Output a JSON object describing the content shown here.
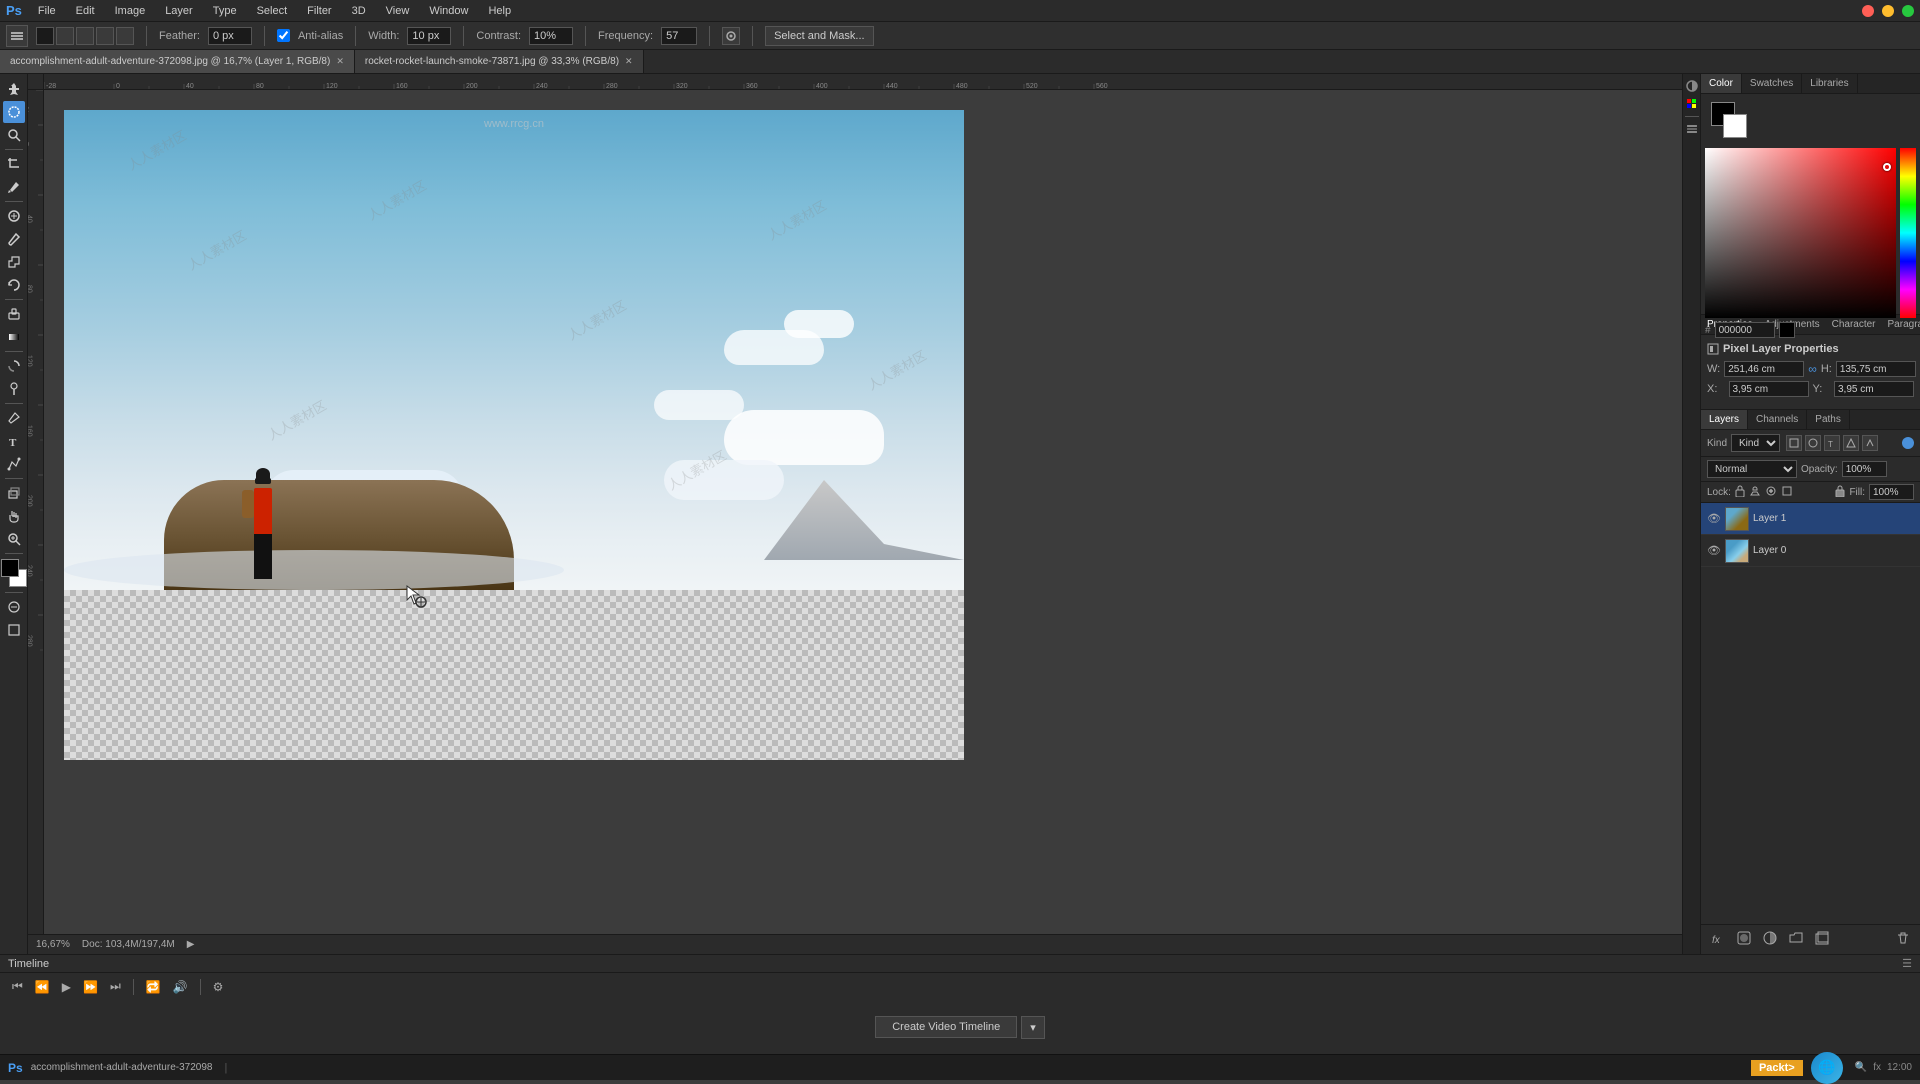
{
  "app": {
    "title": "Adobe Photoshop",
    "watermark": "www.rrcg.cn"
  },
  "menu": {
    "items": [
      "PS",
      "File",
      "Edit",
      "Image",
      "Layer",
      "Type",
      "Select",
      "Filter",
      "3D",
      "View",
      "Window",
      "Help"
    ]
  },
  "toolbar": {
    "feather_label": "Feather:",
    "feather_value": "0 px",
    "antialias_label": "Anti-alias",
    "width_label": "Width:",
    "width_value": "10 px",
    "contrast_label": "Contrast:",
    "contrast_value": "10%",
    "frequency_label": "Frequency:",
    "frequency_value": "57",
    "select_mask_btn": "Select and Mask..."
  },
  "tabs": [
    {
      "label": "accomplishment-adult-adventure-372098.jpg @ 16,7% (Layer 1, RGB/8)",
      "active": true,
      "closeable": true
    },
    {
      "label": "rocket-rocket-launch-smoke-73871.jpg @ 33,3% (RGB/8)",
      "active": false,
      "closeable": true
    }
  ],
  "tools": [
    "move",
    "rectangle-select",
    "lasso",
    "quick-select",
    "crop",
    "eyedropper",
    "spot-heal",
    "brush",
    "clone",
    "history-brush",
    "eraser",
    "gradient",
    "blur",
    "dodge",
    "pen",
    "type",
    "path-select",
    "shape",
    "hand",
    "zoom",
    "foreground-color",
    "background-color",
    "extra"
  ],
  "color_panel": {
    "tabs": [
      "Color",
      "Swatches",
      "Libraries"
    ],
    "active_tab": "Color",
    "swatches_title": "Swatches",
    "swatches": [
      "#ff0000",
      "#ff8000",
      "#ffff00",
      "#00ff00",
      "#00ffff",
      "#0000ff",
      "#8000ff",
      "#ff00ff",
      "#000000",
      "#444444",
      "#888888",
      "#bbbbbb",
      "#ffffff",
      "#ff6666",
      "#ffaa66",
      "#ffff88",
      "#aaffaa",
      "#aaffff",
      "#aaaaff",
      "#ffaaff"
    ]
  },
  "properties_panel": {
    "tabs": [
      "Properties",
      "Adjustments",
      "Character",
      "Paragraph"
    ],
    "active_tab": "Properties",
    "title": "Pixel Layer Properties",
    "w_label": "W:",
    "w_value": "251,46 cm",
    "h_label": "H:",
    "h_value": "135,75 cm",
    "x_label": "X:",
    "x_value": "3,95 cm",
    "y_label": "Y:",
    "y_value": "3,95 cm",
    "link_icon": "∞"
  },
  "layers_panel": {
    "tabs": [
      "Layers",
      "Channels",
      "Paths"
    ],
    "active_tab": "Layers",
    "kind_label": "Kind",
    "blend_mode": "Normal",
    "opacity_label": "Opacity:",
    "opacity_value": "100%",
    "fill_label": "Fill:",
    "fill_value": "100%",
    "lock_label": "Lock:",
    "layers": [
      {
        "name": "Layer 1",
        "visible": true,
        "active": true
      },
      {
        "name": "Layer 0",
        "visible": true,
        "active": false
      }
    ],
    "footer_buttons": [
      "fx",
      "mask",
      "adj",
      "group",
      "new",
      "delete"
    ]
  },
  "timeline": {
    "title": "Timeline",
    "create_video_btn": "Create Video Timeline",
    "controls": [
      "first",
      "prev",
      "play",
      "next",
      "last",
      "loop",
      "audio",
      "settings"
    ]
  },
  "status_bar": {
    "zoom": "16,67%",
    "doc_size": "Doc: 103,4M/197,4M"
  },
  "canvas": {
    "zoom": "16.67%"
  }
}
